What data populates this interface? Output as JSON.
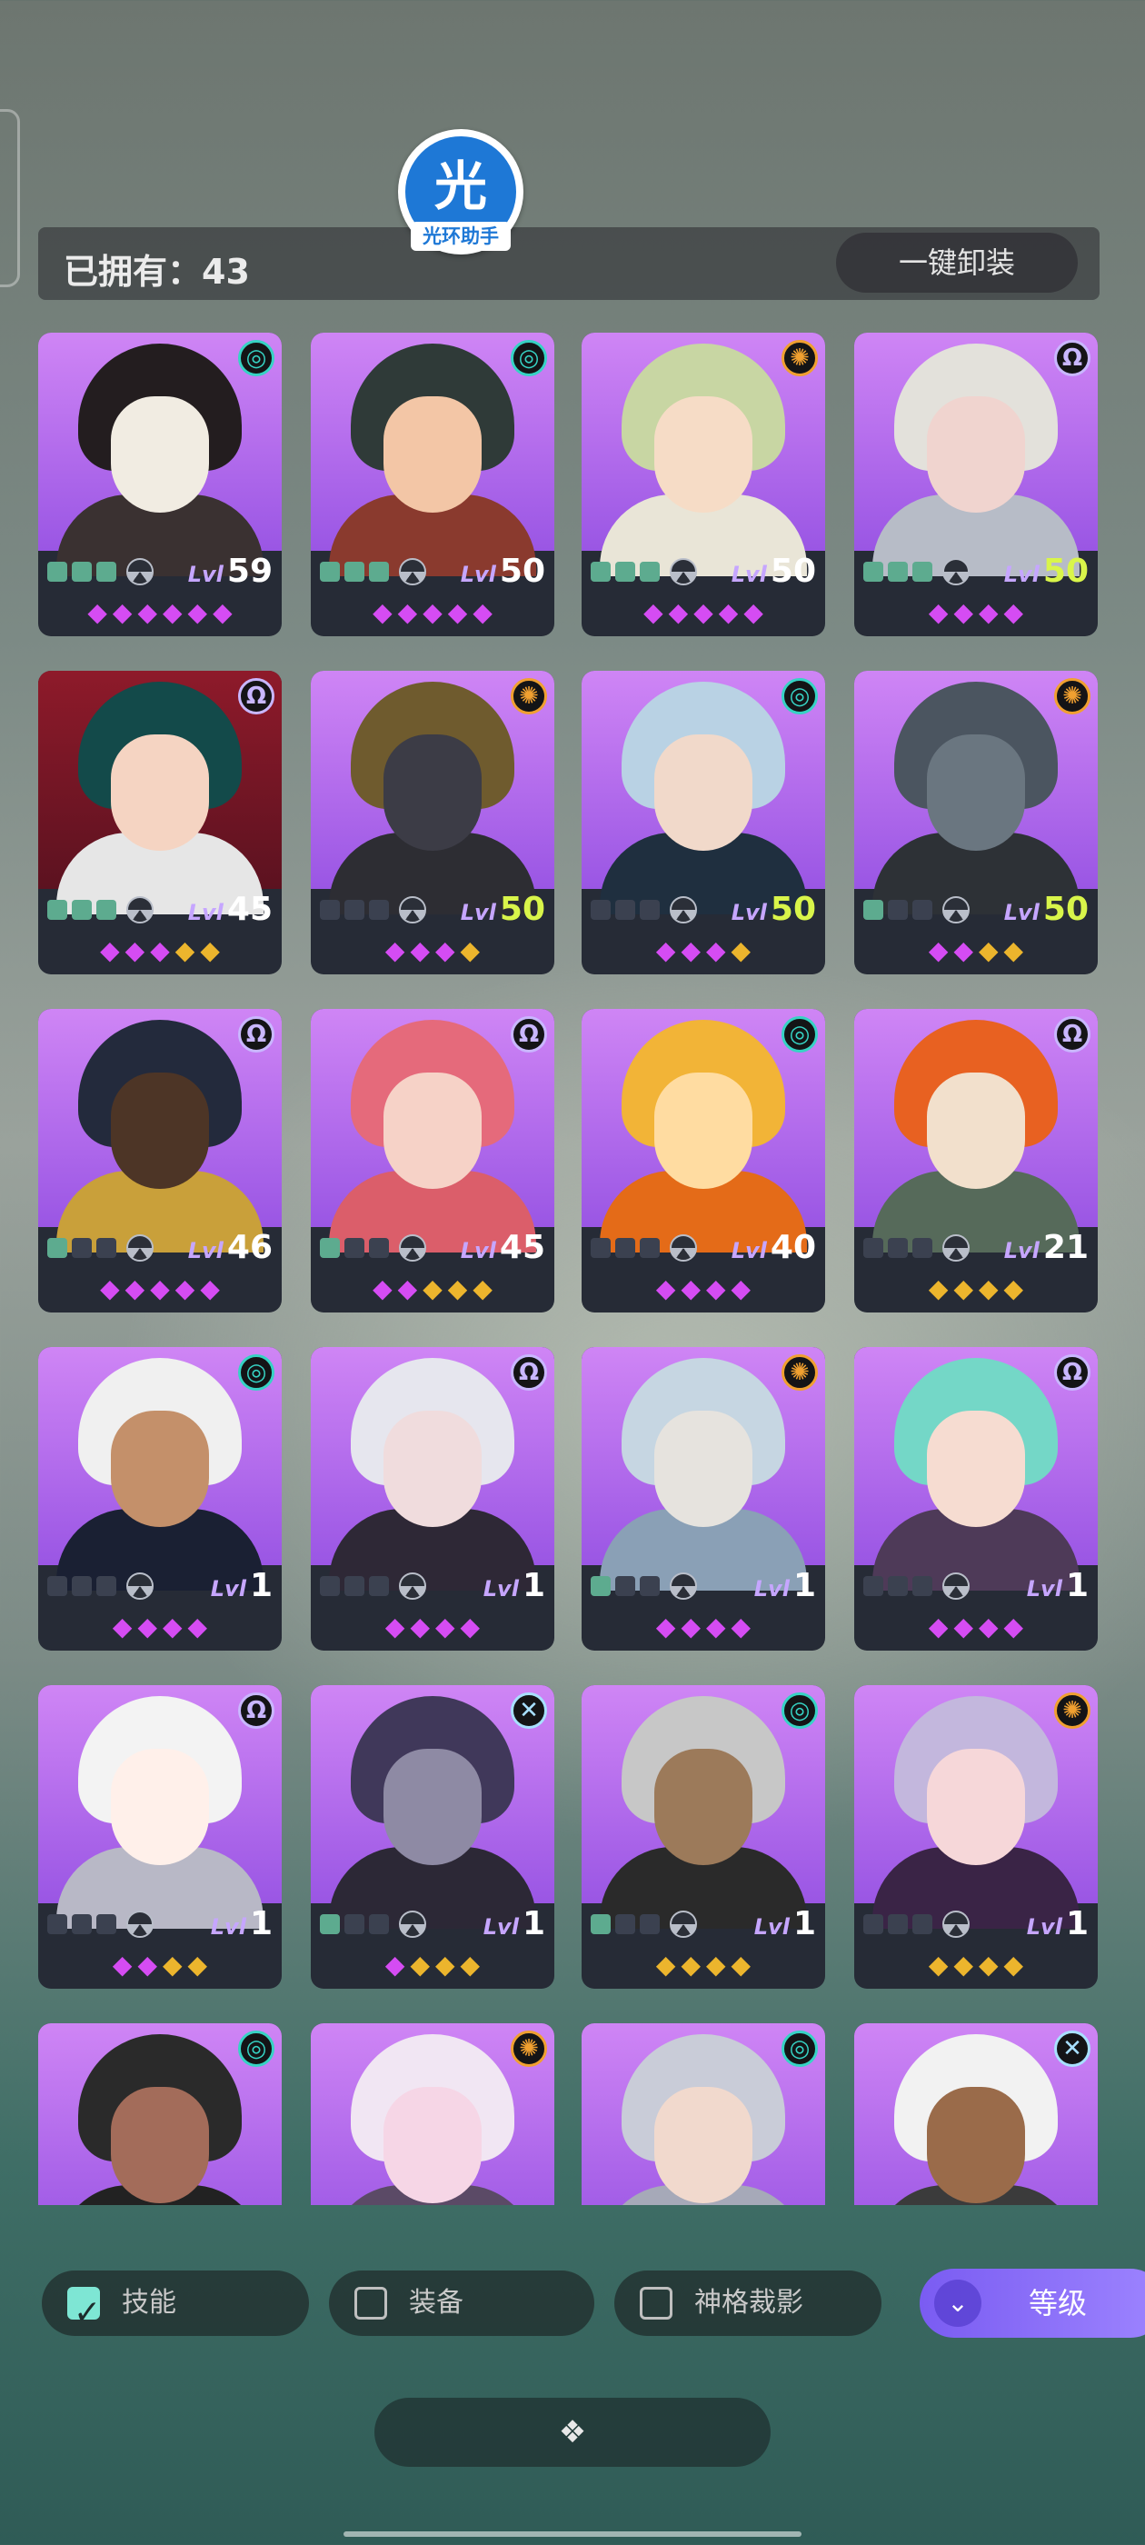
{
  "header": {
    "owned_label": "已拥有：43",
    "unequip_label": "一键卸装",
    "logo_glyph": "光",
    "logo_caption": "光环助手"
  },
  "heroes": [
    {
      "level": "59",
      "level_max": false,
      "element": "wind",
      "skills_on": 3,
      "gems": "ppppp p"
    },
    {
      "level": "50",
      "level_max": false,
      "element": "wind",
      "skills_on": 3,
      "gems": "ppppp"
    },
    {
      "level": "50",
      "level_max": false,
      "element": "sun",
      "skills_on": 3,
      "gems": "ppppp"
    },
    {
      "level": "50",
      "level_max": true,
      "element": "omega",
      "skills_on": 3,
      "gems": "pppp"
    },
    {
      "level": "45",
      "level_max": false,
      "element": "omega",
      "skills_on": 3,
      "gems": "pppyy"
    },
    {
      "level": "50",
      "level_max": true,
      "element": "sun",
      "skills_on": 0,
      "gems": "pppy"
    },
    {
      "level": "50",
      "level_max": true,
      "element": "wind",
      "skills_on": 0,
      "gems": "pppy"
    },
    {
      "level": "50",
      "level_max": true,
      "element": "sun",
      "skills_on": 1,
      "gems": "ppyy"
    },
    {
      "level": "46",
      "level_max": false,
      "element": "omega",
      "skills_on": 1,
      "gems": "ppppp"
    },
    {
      "level": "45",
      "level_max": false,
      "element": "omega",
      "skills_on": 1,
      "gems": "ppyyy"
    },
    {
      "level": "40",
      "level_max": false,
      "element": "wind",
      "skills_on": 0,
      "gems": "pppp"
    },
    {
      "level": "21",
      "level_max": false,
      "element": "omega",
      "skills_on": 0,
      "gems": "yyyy"
    },
    {
      "level": "1",
      "level_max": false,
      "element": "wind",
      "skills_on": 0,
      "gems": "pppp"
    },
    {
      "level": "1",
      "level_max": false,
      "element": "omega",
      "skills_on": 0,
      "gems": "pppp"
    },
    {
      "level": "1",
      "level_max": false,
      "element": "sun",
      "skills_on": 1,
      "gems": "pppp"
    },
    {
      "level": "1",
      "level_max": false,
      "element": "omega",
      "skills_on": 0,
      "gems": "pppp"
    },
    {
      "level": "1",
      "level_max": false,
      "element": "omega",
      "skills_on": 0,
      "gems": "ppyy"
    },
    {
      "level": "1",
      "level_max": false,
      "element": "cross",
      "skills_on": 1,
      "gems": "pyyy"
    },
    {
      "level": "1",
      "level_max": false,
      "element": "wind",
      "skills_on": 1,
      "gems": "yyyy"
    },
    {
      "level": "1",
      "level_max": false,
      "element": "sun",
      "skills_on": 0,
      "gems": "yyyy"
    },
    {
      "level": "",
      "level_max": false,
      "element": "wind",
      "skills_on": 0,
      "gems": ""
    },
    {
      "level": "",
      "level_max": false,
      "element": "sun",
      "skills_on": 0,
      "gems": ""
    },
    {
      "level": "",
      "level_max": false,
      "element": "wind",
      "skills_on": 0,
      "gems": ""
    },
    {
      "level": "",
      "level_max": false,
      "element": "cross",
      "skills_on": 0,
      "gems": ""
    }
  ],
  "level_tag": "Lvl",
  "filters": [
    {
      "label": "技能",
      "checked": true
    },
    {
      "label": "装备",
      "checked": false
    },
    {
      "label": "神格裁影",
      "checked": false
    }
  ],
  "sort": {
    "label": "等级",
    "icon": "double-chevron-down-icon"
  },
  "expand": {
    "icon": "diamonds-icon",
    "glyph": "❖"
  },
  "colors": {
    "accent": "#8b6cf6",
    "card_bg": "#262b36",
    "max_level": "#d9f54a",
    "gem_purple": "#d54cf3",
    "gem_yellow": "#ecb52d"
  }
}
